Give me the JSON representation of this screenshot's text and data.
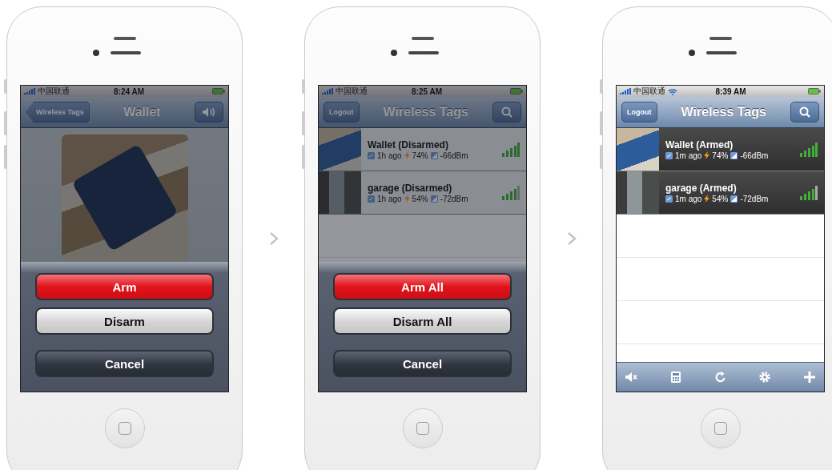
{
  "phones": [
    {
      "status": {
        "carrier": "中国联通",
        "time": "8:24 AM",
        "wifi": false
      },
      "nav": {
        "left": {
          "kind": "back",
          "label": "Wireless Tags"
        },
        "title": "Wallet",
        "right": {
          "kind": "speaker"
        }
      },
      "content": {
        "kind": "photo"
      },
      "action_sheet": {
        "buttons": [
          {
            "label": "Arm",
            "kind": "destructive"
          },
          {
            "label": "Disarm",
            "kind": "default"
          },
          {
            "label": "Cancel",
            "kind": "cancel"
          }
        ]
      }
    },
    {
      "status": {
        "carrier": "中国联通",
        "time": "8:25 AM",
        "wifi": false
      },
      "nav": {
        "left": {
          "kind": "plain",
          "label": "Logout"
        },
        "title": "Wireless Tags",
        "right": {
          "kind": "search"
        }
      },
      "content": {
        "kind": "list",
        "tags": [
          {
            "name": "Wallet (Disarmed)",
            "armed": false,
            "age": "1h ago",
            "battery": "74%",
            "signal": "-66dBm"
          },
          {
            "name": "garage (Disarmed)",
            "armed": false,
            "age": "1h ago",
            "battery": "54%",
            "signal": "-72dBm"
          }
        ]
      },
      "action_sheet": {
        "buttons": [
          {
            "label": "Arm All",
            "kind": "destructive"
          },
          {
            "label": "Disarm All",
            "kind": "default"
          },
          {
            "label": "Cancel",
            "kind": "cancel"
          }
        ]
      }
    },
    {
      "status": {
        "carrier": "中国联通",
        "time": "8:39 AM",
        "wifi": true
      },
      "nav": {
        "left": {
          "kind": "plain",
          "label": "Logout"
        },
        "title": "Wireless Tags",
        "right": {
          "kind": "search"
        }
      },
      "content": {
        "kind": "list",
        "tags": [
          {
            "name": "Wallet (Armed)",
            "armed": true,
            "age": "1m ago",
            "battery": "74%",
            "signal": "-66dBm"
          },
          {
            "name": "garage (Armed)",
            "armed": true,
            "age": "1m ago",
            "battery": "54%",
            "signal": "-72dBm"
          }
        ]
      },
      "toolbar": true
    }
  ]
}
